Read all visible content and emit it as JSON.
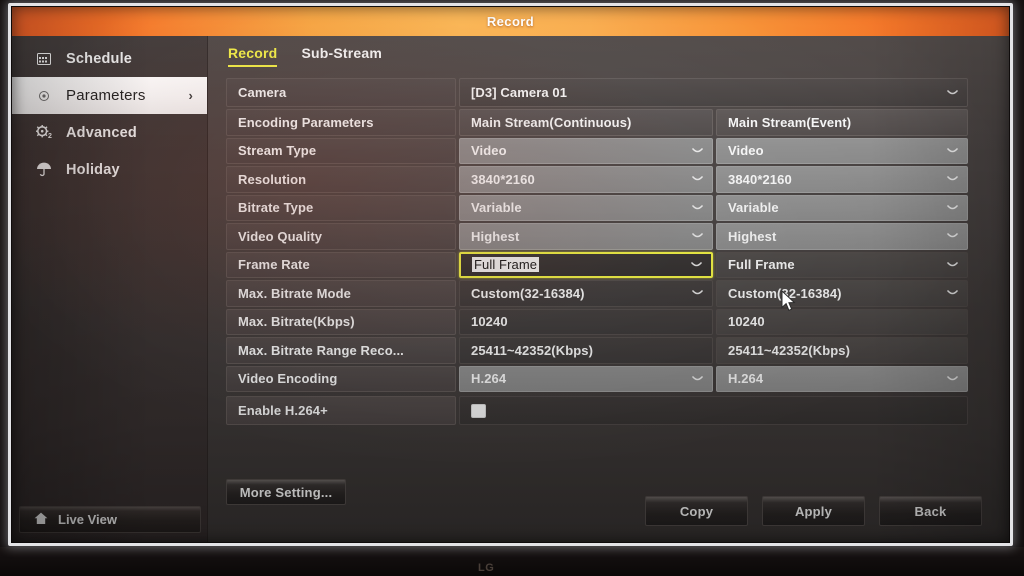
{
  "window": {
    "title": "Record",
    "device_brand": "LG"
  },
  "sidebar": {
    "items": [
      {
        "label": "Schedule",
        "icon": "calendar-icon",
        "selected": false
      },
      {
        "label": "Parameters",
        "icon": "record-dot-icon",
        "selected": true,
        "chevron": "›"
      },
      {
        "label": "Advanced",
        "icon": "gear-icon",
        "selected": false
      },
      {
        "label": "Holiday",
        "icon": "umbrella-icon",
        "selected": false
      }
    ],
    "live_view": {
      "label": "Live View",
      "icon": "home-icon"
    }
  },
  "tabs": [
    {
      "label": "Record",
      "active": true
    },
    {
      "label": "Sub-Stream",
      "active": false
    }
  ],
  "table": {
    "camera_row": {
      "label": "Camera",
      "value": "[D3] Camera 01"
    },
    "headers": {
      "label": "Encoding Parameters",
      "col_a": "Main Stream(Continuous)",
      "col_b": "Main Stream(Event)"
    },
    "rows": [
      {
        "label": "Stream Type",
        "col_a": "Video",
        "col_b": "Video",
        "dropdown": true
      },
      {
        "label": "Resolution",
        "col_a": "3840*2160",
        "col_b": "3840*2160",
        "dropdown": true
      },
      {
        "label": "Bitrate Type",
        "col_a": "Variable",
        "col_b": "Variable",
        "dropdown": true
      },
      {
        "label": "Video Quality",
        "col_a": "Highest",
        "col_b": "Highest",
        "dropdown": true
      },
      {
        "label": "Frame Rate",
        "col_a": "Full Frame",
        "col_b": "Full Frame",
        "dropdown": true,
        "focused": true
      },
      {
        "label": "Max. Bitrate Mode",
        "col_a": "Custom(32-16384)",
        "col_b": "Custom(32-16384)",
        "dropdown": true
      },
      {
        "label": "Max. Bitrate(Kbps)",
        "col_a": "10240",
        "col_b": "10240",
        "dropdown": false
      },
      {
        "label": "Max. Bitrate Range Reco...",
        "col_a": "25411~42352(Kbps)",
        "col_b": "25411~42352(Kbps)",
        "dropdown": false
      },
      {
        "label": "Video Encoding",
        "col_a": "H.264",
        "col_b": "H.264",
        "dropdown": true
      }
    ],
    "checkbox_row": {
      "label": "Enable H.264+",
      "checked": false
    }
  },
  "buttons": {
    "more_setting": "More Setting...",
    "copy": "Copy",
    "apply": "Apply",
    "back": "Back"
  },
  "colors": {
    "accent_orange": "#f78c2c",
    "active_tab_yellow": "#f2ef42",
    "focus_yellow": "#eff03f",
    "panel_bg": "#3e3938",
    "sidebar_bg": "#393231"
  }
}
